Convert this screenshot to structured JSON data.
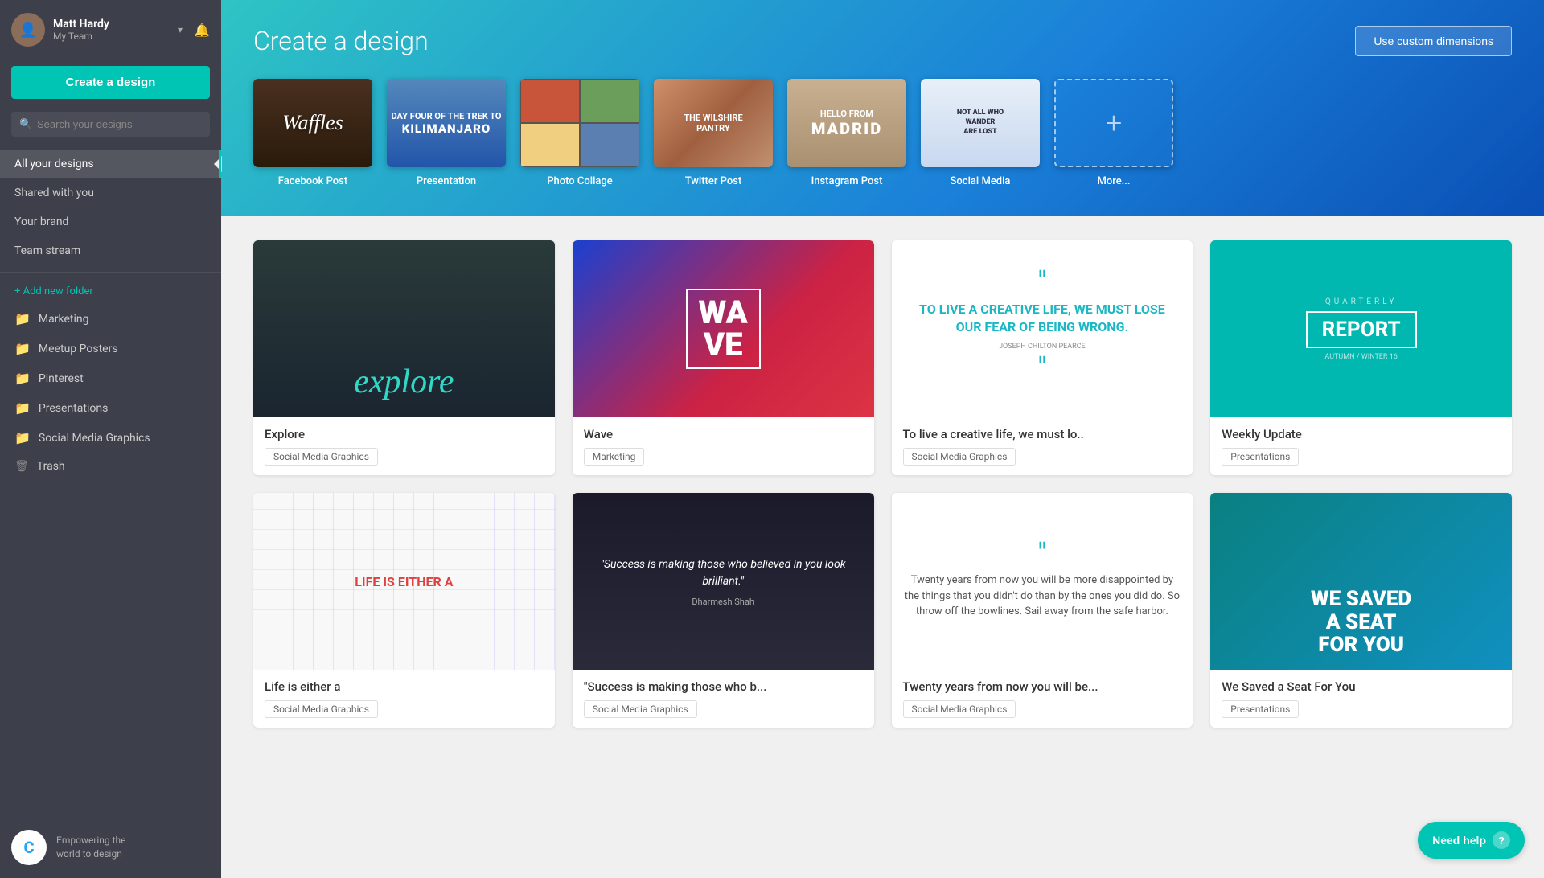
{
  "sidebar": {
    "user": {
      "name": "Matt Hardy",
      "team": "My Team"
    },
    "create_button": "Create a design",
    "search_placeholder": "Search your designs",
    "nav": [
      {
        "id": "all-designs",
        "label": "All your designs",
        "active": true
      },
      {
        "id": "shared",
        "label": "Shared with you"
      },
      {
        "id": "brand",
        "label": "Your brand"
      },
      {
        "id": "team",
        "label": "Team stream"
      }
    ],
    "add_folder": "+ Add new folder",
    "folders": [
      {
        "id": "marketing",
        "label": "Marketing",
        "icon": "folder"
      },
      {
        "id": "meetup",
        "label": "Meetup Posters",
        "icon": "folder"
      },
      {
        "id": "pinterest",
        "label": "Pinterest",
        "icon": "folder"
      },
      {
        "id": "presentations",
        "label": "Presentations",
        "icon": "folder"
      },
      {
        "id": "social-media",
        "label": "Social Media Graphics",
        "icon": "folder"
      },
      {
        "id": "trash",
        "label": "Trash",
        "icon": "trash"
      }
    ],
    "footer_text": "Empowering the\nworld to design"
  },
  "hero": {
    "title": "Create a design",
    "custom_dimensions_label": "Use custom dimensions",
    "templates": [
      {
        "id": "facebook",
        "label": "Facebook Post"
      },
      {
        "id": "presentation",
        "label": "Presentation"
      },
      {
        "id": "collage",
        "label": "Photo Collage"
      },
      {
        "id": "twitter",
        "label": "Twitter Post"
      },
      {
        "id": "instagram",
        "label": "Instagram Post"
      },
      {
        "id": "social",
        "label": "Social Media"
      },
      {
        "id": "more",
        "label": "More..."
      }
    ]
  },
  "designs": [
    {
      "id": "explore",
      "name": "Explore",
      "tag": "Social Media Graphics",
      "thumb_type": "explore"
    },
    {
      "id": "wave",
      "name": "Wave",
      "tag": "Marketing",
      "thumb_type": "wave"
    },
    {
      "id": "quote-creative",
      "name": "To live a creative life, we must lo..",
      "tag": "Social Media Graphics",
      "thumb_type": "quote"
    },
    {
      "id": "weekly-update",
      "name": "Weekly Update",
      "tag": "Presentations",
      "thumb_type": "report"
    },
    {
      "id": "life",
      "name": "Life is either a",
      "tag": "Social Media Graphics",
      "thumb_type": "life"
    },
    {
      "id": "success",
      "name": "\"Success is making those who b...",
      "tag": "Social Media Graphics",
      "thumb_type": "success"
    },
    {
      "id": "quote2",
      "name": "Twenty years from now you will be...",
      "tag": "Social Media Graphics",
      "thumb_type": "quote2"
    },
    {
      "id": "conference",
      "name": "We Saved a Seat For You",
      "tag": "Presentations",
      "thumb_type": "conf"
    }
  ],
  "need_help": "Need help"
}
